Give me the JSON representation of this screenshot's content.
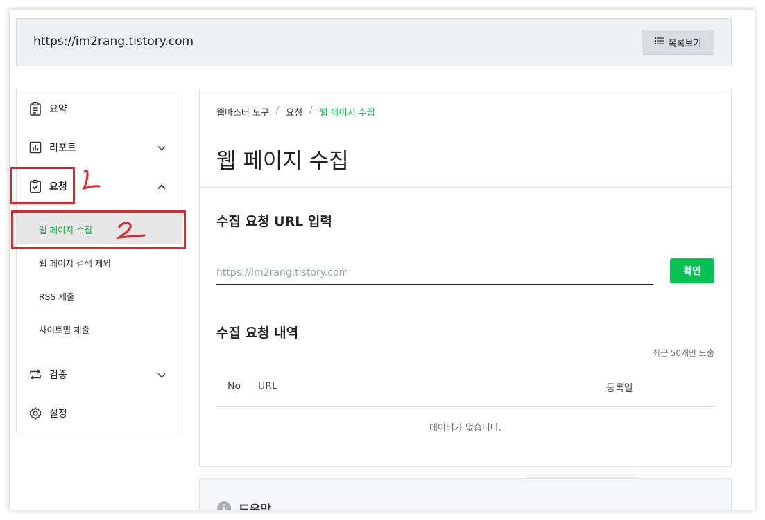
{
  "topbar": {
    "site_url": "https://im2rang.tistory.com",
    "list_button_label": "목록보기"
  },
  "sidebar": {
    "items": [
      {
        "label": "요약",
        "icon": "clipboard-list-icon"
      },
      {
        "label": "리포트",
        "icon": "bar-chart-icon"
      },
      {
        "label": "요청",
        "icon": "clipboard-check-icon"
      },
      {
        "label": "검증",
        "icon": "repeat-icon"
      },
      {
        "label": "설정",
        "icon": "gear-icon"
      }
    ],
    "sub_items": [
      {
        "label": "웹 페이지 수집",
        "active": true
      },
      {
        "label": "웹 페이지 검색 제외",
        "active": false
      },
      {
        "label": "RSS 제출",
        "active": false
      },
      {
        "label": "사이트맵 제출",
        "active": false
      }
    ]
  },
  "annotations": {
    "one": "1",
    "two": "2",
    "color": "#e0262a"
  },
  "main": {
    "breadcrumb": [
      "웹마스터 도구",
      "요청",
      "웹 페이지 수집"
    ],
    "breadcrumb_sep": "/",
    "title": "웹 페이지 수집",
    "input_section_title": "수집 요청 URL 입력",
    "input_placeholder": "https://im2rang.tistory.com",
    "confirm_label": "확인",
    "history_title": "수집 요청 내역",
    "recent_note": "최근 50개만 노출",
    "table_headers": {
      "no": "No",
      "url": "URL",
      "date": "등록일"
    },
    "empty_message": "데이터가 없습니다."
  },
  "help": {
    "label": "도움말",
    "icon": "info-icon"
  },
  "colors": {
    "accent_green": "#07c153",
    "active_text": "#07b53b"
  }
}
